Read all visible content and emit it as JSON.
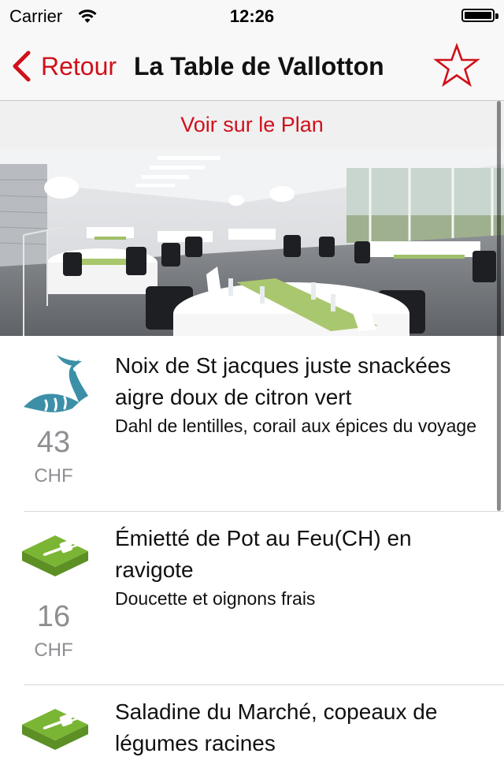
{
  "status_bar": {
    "carrier": "Carrier",
    "time": "12:26",
    "battery_level": 1.0
  },
  "nav": {
    "back_label": "Retour",
    "title": "La Table de Vallotton",
    "favorite_icon": "star-icon"
  },
  "plan_link": "Voir sur le Plan",
  "colors": {
    "accent": "#d0101a",
    "fish_icon": "#3d8fa8",
    "fork_icon": "#7bb534",
    "secondary_text": "#8e8e93"
  },
  "menu_items": [
    {
      "icon": "fish-icon",
      "title": "Noix de St jacques juste snackées aigre doux de citron vert",
      "subtitle": "Dahl de lentilles, corail aux épices du voyage",
      "price": "43",
      "currency": "CHF"
    },
    {
      "icon": "fork-icon",
      "title": "Émietté de Pot au Feu(CH) en ravigote",
      "subtitle": "Doucette et oignons frais",
      "price": "16",
      "currency": "CHF"
    },
    {
      "icon": "fork-icon",
      "title": "Saladine du Marché, copeaux de légumes racines",
      "subtitle": "",
      "price": "",
      "currency": ""
    }
  ]
}
